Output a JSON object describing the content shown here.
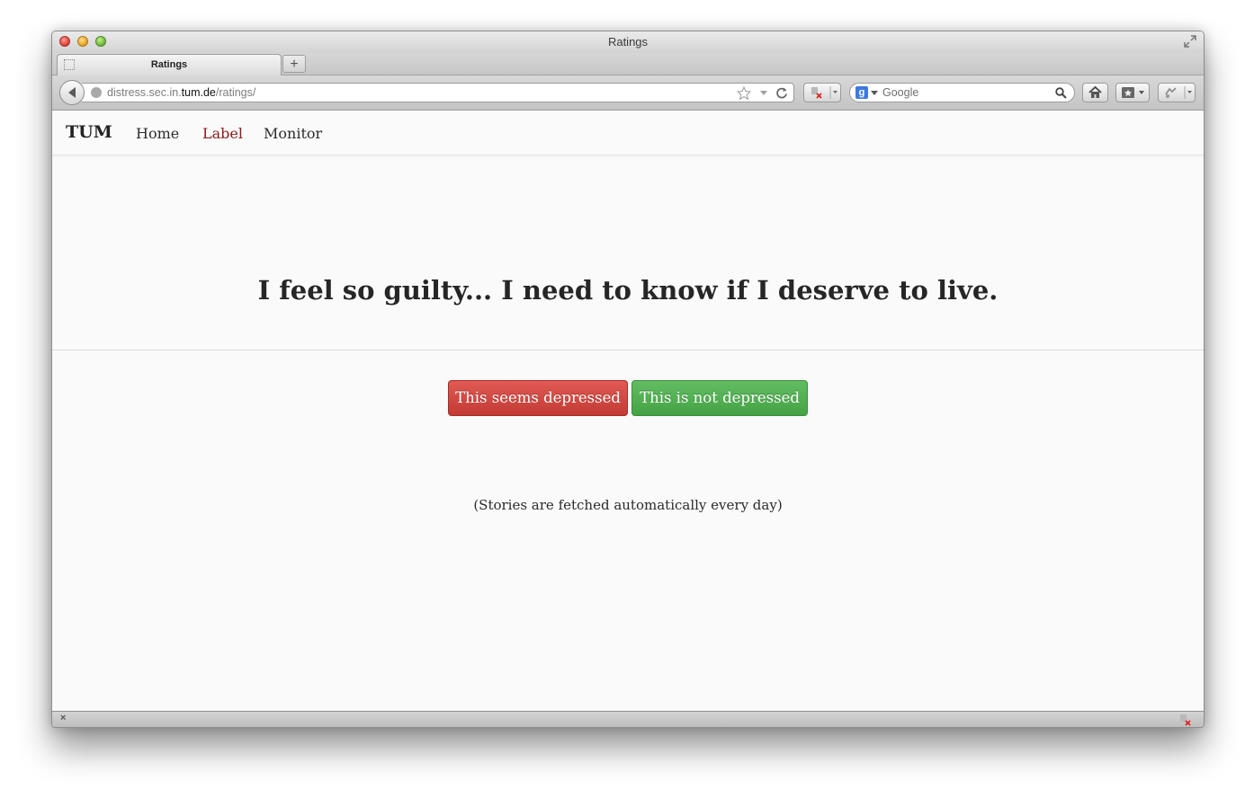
{
  "window": {
    "title": "Ratings"
  },
  "tabs": [
    {
      "label": "Ratings"
    }
  ],
  "toolbar": {
    "new_tab_label": "+",
    "url": {
      "host_prefix": "distress.sec.in.",
      "host_domain": "tum.de",
      "path": "/ratings/"
    },
    "search": {
      "engine": "Google"
    }
  },
  "site": {
    "brand": "TUM",
    "nav": [
      {
        "label": "Home",
        "active": false
      },
      {
        "label": "Label",
        "active": true
      },
      {
        "label": "Monitor",
        "active": false
      }
    ]
  },
  "story": {
    "text": "I feel so guilty... I need to know if I deserve to live."
  },
  "actions": {
    "depressed_label": "This seems depressed",
    "not_depressed_label": "This is not depressed"
  },
  "footer_note": "(Stories are fetched automatically every day)",
  "statusbar": {
    "close_glyph": "×"
  },
  "colors": {
    "active_nav": "#8b1a1a",
    "danger": "#c9403a",
    "success": "#4cae4c"
  }
}
